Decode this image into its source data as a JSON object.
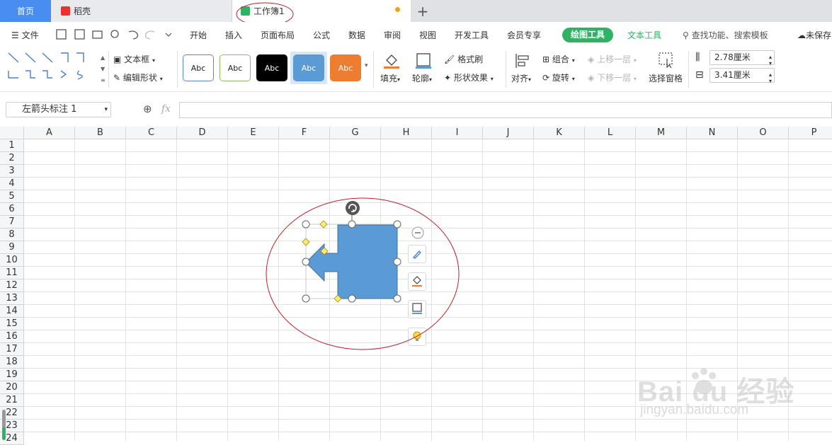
{
  "tabs": {
    "home": "首页",
    "docer": "稻壳",
    "workbook": "工作簿1"
  },
  "menu": {
    "file": "文件",
    "items": [
      "开始",
      "插入",
      "页面布局",
      "公式",
      "数据",
      "审阅",
      "视图",
      "开发工具",
      "会员专享"
    ],
    "drawing_tools": "绘图工具",
    "text_tools": "文本工具",
    "search": "查找功能、搜索模板",
    "save_status": "未保存"
  },
  "ribbon": {
    "textbox": "文本框",
    "edit_shape": "编辑形状",
    "style_label": "Abc",
    "fill": "填充",
    "outline": "轮廓",
    "format_painter": "格式刷",
    "shape_effects": "形状效果",
    "align": "对齐",
    "group": "组合",
    "rotate": "旋转",
    "bring_forward": "上移一层",
    "send_backward": "下移一层",
    "selection_pane": "选择窗格",
    "height": "2.78厘米",
    "width": "3.41厘米"
  },
  "formula_bar": {
    "name_box": "左箭头标注 1",
    "fx": "fx"
  },
  "columns": [
    "A",
    "B",
    "C",
    "D",
    "E",
    "F",
    "G",
    "H",
    "I",
    "J",
    "K",
    "L",
    "M",
    "N",
    "O",
    "P"
  ],
  "rows": [
    "1",
    "2",
    "3",
    "4",
    "5",
    "6",
    "7",
    "8",
    "9",
    "10",
    "11",
    "12",
    "13",
    "14",
    "15",
    "16",
    "17",
    "18",
    "19",
    "20",
    "21",
    "22",
    "23",
    "24"
  ],
  "watermark": {
    "brand": "Bai du 经验",
    "url": "jingyan.baidu.com"
  },
  "colors": {
    "shape_fill": "#5b9bd5",
    "accent_green": "#2fb265",
    "home_tab": "#4a8df0",
    "annotation_ellipse": "#c0202a"
  }
}
